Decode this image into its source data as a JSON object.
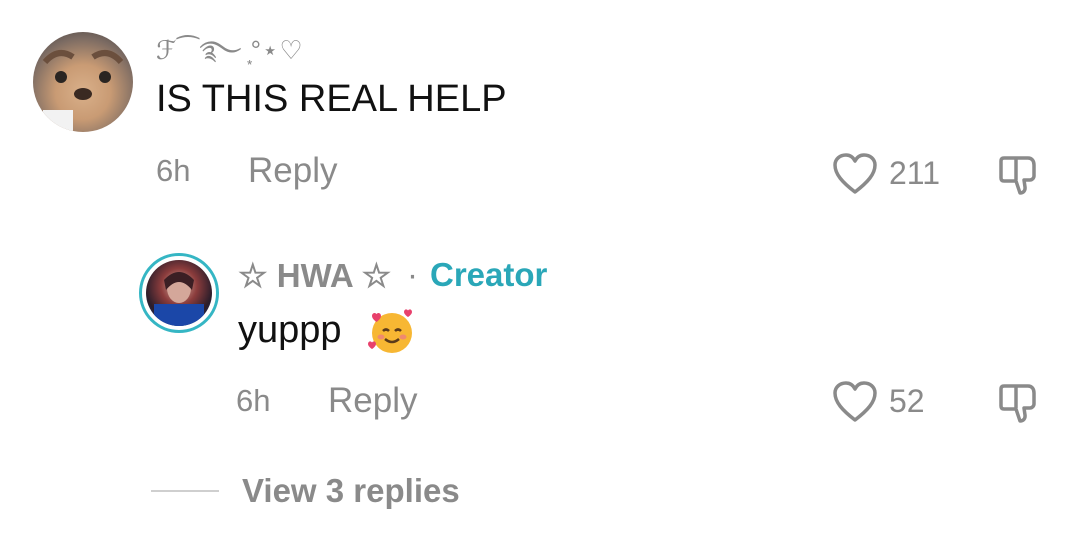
{
  "comments": [
    {
      "username": "ℱ⁀࿐ ͙°⋆♡",
      "text": "IS THIS REAL HELP",
      "time": "6h",
      "reply_label": "Reply",
      "likes": "211",
      "avatar_icon": "profile-avatar"
    },
    {
      "username": "☆ HWA ☆",
      "separator": "·",
      "creator_label": "Creator",
      "text": "yuppp",
      "emoji_icon": "smiling-face-with-hearts",
      "time": "6h",
      "reply_label": "Reply",
      "likes": "52",
      "avatar_icon": "profile-avatar"
    }
  ],
  "view_replies_label": "View 3 replies",
  "colors": {
    "creator_accent": "#2aa7b8",
    "avatar_ring": "#35b6c4",
    "muted_text": "#8a8a8a"
  }
}
